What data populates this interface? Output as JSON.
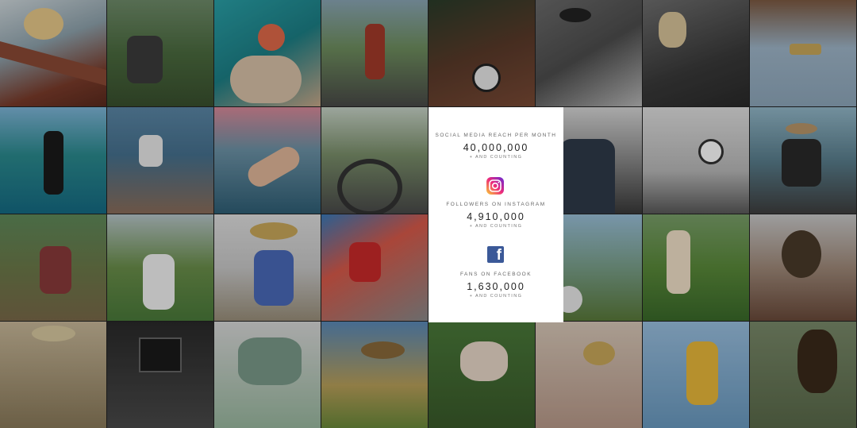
{
  "stats": {
    "social": {
      "label": "SOCIAL MEDIA REACH PER MONTH",
      "value": "40,000,000",
      "sub": "+ AND COUNTING"
    },
    "instagram": {
      "label": "FOLLOWERS ON INSTAGRAM",
      "value": "4,910,000",
      "sub": "+ AND COUNTING",
      "icon": "instagram-icon"
    },
    "facebook": {
      "label": "FANS ON FACEBOOK",
      "value": "1,630,000",
      "sub": "+ AND COUNTING",
      "icon": "facebook-icon",
      "icon_glyph": "f"
    }
  },
  "colors": {
    "facebook_blue": "#3b5998",
    "card_bg": "#ffffff",
    "page_bg": "#1a1a1a"
  }
}
